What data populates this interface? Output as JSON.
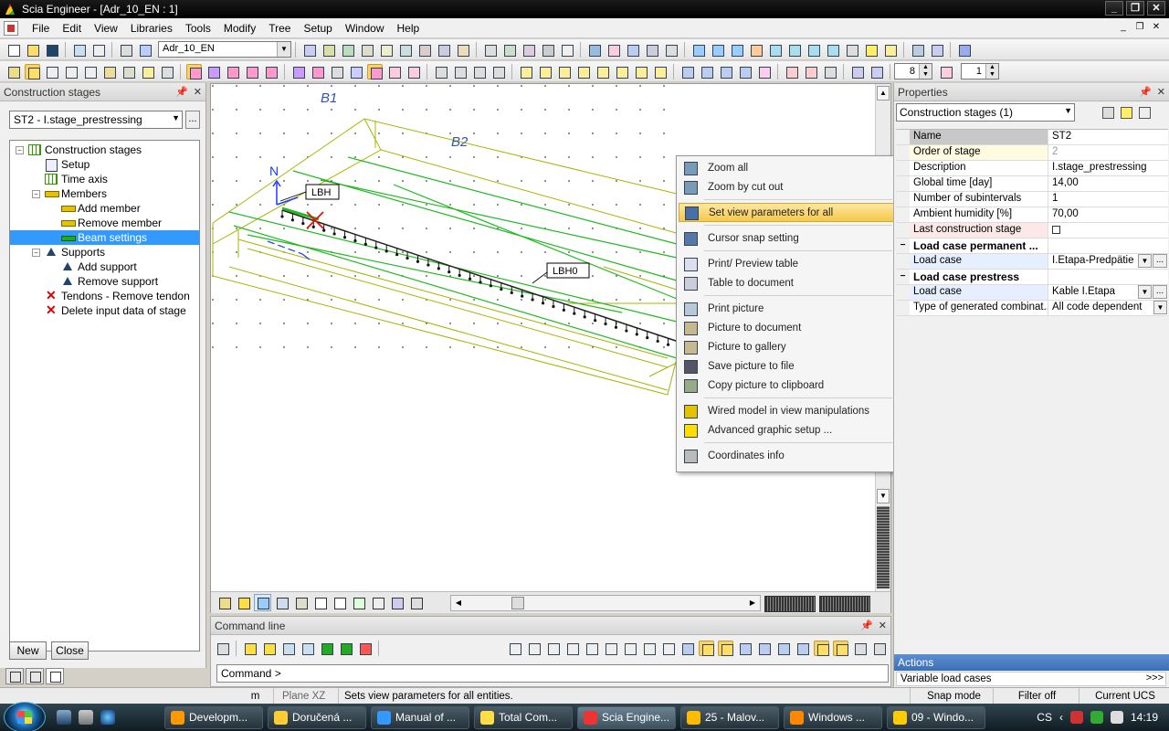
{
  "window": {
    "title": "Scia Engineer - [Adr_10_EN : 1]",
    "controls": [
      "_",
      "❐",
      "✕"
    ],
    "mdi_controls": [
      "_",
      "❐",
      "✕"
    ]
  },
  "menu": [
    "File",
    "Edit",
    "View",
    "Libraries",
    "Tools",
    "Modify",
    "Tree",
    "Setup",
    "Window",
    "Help"
  ],
  "toolbar": {
    "project_combo": "Adr_10_EN",
    "spin1": "8",
    "spin2": "1"
  },
  "left_panel": {
    "title": "Construction stages",
    "stage_select": "ST2 - I.stage_prestressing",
    "more": "...",
    "tree": [
      {
        "label": "Construction stages",
        "level": 0,
        "expander": "−",
        "icon": "grid"
      },
      {
        "label": "Setup",
        "level": 1,
        "icon": "doc"
      },
      {
        "label": "Time axis",
        "level": 1,
        "icon": "grid"
      },
      {
        "label": "Members",
        "level": 1,
        "expander": "−",
        "icon": "beam"
      },
      {
        "label": "Add member",
        "level": 2,
        "icon": "beam"
      },
      {
        "label": "Remove member",
        "level": 2,
        "icon": "beam"
      },
      {
        "label": "Beam settings",
        "level": 2,
        "icon": "green",
        "selected": true
      },
      {
        "label": "Supports",
        "level": 1,
        "expander": "−",
        "icon": "sup"
      },
      {
        "label": "Add support",
        "level": 2,
        "icon": "sup"
      },
      {
        "label": "Remove support",
        "level": 2,
        "icon": "sup"
      },
      {
        "label": "Tendons - Remove tendon",
        "level": 1,
        "icon": "red"
      },
      {
        "label": "Delete input data of stage",
        "level": 1,
        "icon": "red"
      }
    ],
    "new_button": "New",
    "close_button": "Close"
  },
  "viewport": {
    "labels": {
      "b1": "B1",
      "b2": "B2",
      "lbh": "LBH",
      "lbh0": "LBH0",
      "axis_n": "N"
    },
    "colors": {
      "wire": "#a8b400",
      "green": "#22b822",
      "blue": "#1a3cff",
      "red": "#e01010"
    }
  },
  "context_menu": {
    "items": [
      {
        "label": "Zoom all",
        "icon": "zoom-all-icon",
        "color": "#7a9bb8"
      },
      {
        "label": "Zoom by cut out",
        "icon": "zoom-cut-icon",
        "color": "#7a9bb8"
      },
      {
        "sep": true
      },
      {
        "label": "Set view parameters for all",
        "icon": "view-parameters-icon",
        "color": "#4a6fa8",
        "hover": true
      },
      {
        "sep": true
      },
      {
        "label": "Cursor snap setting",
        "icon": "cursor-snap-icon",
        "color": "#5577aa"
      },
      {
        "sep": true
      },
      {
        "label": "Print/ Preview table",
        "icon": "print-table-icon",
        "color": "#dde"
      },
      {
        "label": "Table to document",
        "icon": "table-doc-icon",
        "color": "#ccd"
      },
      {
        "sep": true
      },
      {
        "label": "Print picture",
        "icon": "print-picture-icon",
        "color": "#b8c8d8"
      },
      {
        "label": "Picture to document",
        "icon": "picture-doc-icon",
        "color": "#c8b890"
      },
      {
        "label": "Picture to gallery",
        "icon": "picture-gallery-icon",
        "color": "#c8b890"
      },
      {
        "label": "Save picture to file",
        "icon": "save-picture-icon",
        "color": "#556"
      },
      {
        "label": "Copy picture to clipboard",
        "icon": "copy-picture-icon",
        "color": "#9a8"
      },
      {
        "sep": true
      },
      {
        "label": "Wired model in view manipulations",
        "icon": "wired-model-icon",
        "color": "#e5c200"
      },
      {
        "label": "Advanced graphic setup ...",
        "icon": "graphic-setup-icon",
        "color": "#fd0"
      },
      {
        "sep": true
      },
      {
        "label": "Coordinates info",
        "icon": "coordinates-info-icon",
        "color": "#bbb"
      }
    ]
  },
  "properties": {
    "title": "Properties",
    "selector": "Construction stages (1)",
    "rows": [
      {
        "key": "Name",
        "value": "ST2",
        "style": "header"
      },
      {
        "key": "Order of stage",
        "value": "2",
        "style": "yellow",
        "readonly": true
      },
      {
        "key": "Description",
        "value": "I.stage_prestressing"
      },
      {
        "key": "Global time [day]",
        "value": "14,00"
      },
      {
        "key": "Number of subintervals",
        "value": "1"
      },
      {
        "key": "Ambient humidity [%]",
        "value": "70,00"
      },
      {
        "key": "Last construction stage",
        "value": "",
        "checkbox": true,
        "style": "pink"
      },
      {
        "key": "Load case permanent ...",
        "value": "",
        "section": true,
        "gutter": "−"
      },
      {
        "key": "Load case",
        "value": "I.Etapa-Predpätie",
        "dropdown": true,
        "more": true,
        "style": "blue"
      },
      {
        "key": "Load case prestress",
        "value": "",
        "section": true,
        "gutter": "−"
      },
      {
        "key": "Load case",
        "value": "Kable I.Etapa",
        "dropdown": true,
        "more": true,
        "style": "blue"
      },
      {
        "key": "Type of generated combinat...",
        "value": "All code dependent",
        "dropdown2": true
      }
    ],
    "actions_title": "Actions",
    "actions_row": "Variable load cases",
    "actions_go": ">>>"
  },
  "command_line": {
    "title": "Command line",
    "prompt": "Command >"
  },
  "status_bar": {
    "units": "m",
    "plane": "Plane XZ",
    "message": "Sets view parameters for all entities.",
    "snap": "Snap mode",
    "filter": "Filter off",
    "ucs": "Current UCS"
  },
  "taskbar": {
    "tasks": [
      {
        "label": "Developm...",
        "color": "#f90"
      },
      {
        "label": "Doručená ...",
        "color": "#fc3"
      },
      {
        "label": "Manual of ...",
        "color": "#39f"
      },
      {
        "label": "Total Com...",
        "color": "#fd4"
      },
      {
        "label": "Scia Engine...",
        "color": "#e33",
        "active": true
      },
      {
        "label": "25 - Malov...",
        "color": "#fb0"
      },
      {
        "label": "Windows ...",
        "color": "#f80"
      },
      {
        "label": "09 - Windo...",
        "color": "#fc0"
      }
    ],
    "lang": "CS",
    "time": "14:19"
  }
}
